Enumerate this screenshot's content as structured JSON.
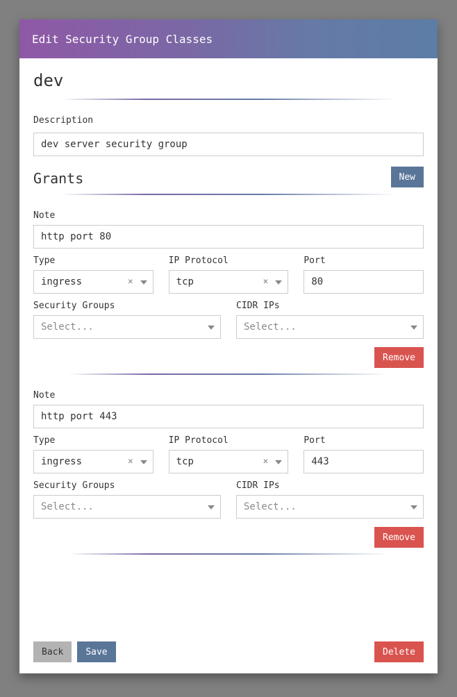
{
  "window": {
    "title": "Edit Security Group Classes"
  },
  "page": {
    "name": "dev"
  },
  "description": {
    "label": "Description",
    "value": "dev server security group"
  },
  "grants": {
    "title": "Grants",
    "new_label": "New",
    "items": [
      {
        "note_label": "Note",
        "note_value": "http port 80",
        "type_label": "Type",
        "type_value": "ingress",
        "proto_label": "IP Protocol",
        "proto_value": "tcp",
        "port_label": "Port",
        "port_value": "80",
        "sg_label": "Security Groups",
        "sg_placeholder": "Select...",
        "cidr_label": "CIDR IPs",
        "cidr_placeholder": "Select...",
        "remove_label": "Remove"
      },
      {
        "note_label": "Note",
        "note_value": "http port 443",
        "type_label": "Type",
        "type_value": "ingress",
        "proto_label": "IP Protocol",
        "proto_value": "tcp",
        "port_label": "Port",
        "port_value": "443",
        "sg_label": "Security Groups",
        "sg_placeholder": "Select...",
        "cidr_label": "CIDR IPs",
        "cidr_placeholder": "Select...",
        "remove_label": "Remove"
      }
    ]
  },
  "footer": {
    "back": "Back",
    "save": "Save",
    "delete": "Delete"
  }
}
